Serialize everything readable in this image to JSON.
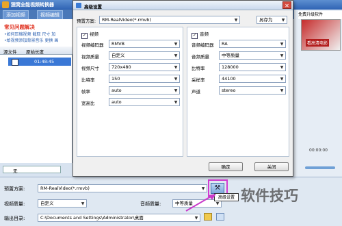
{
  "app": {
    "title": "狸窝全能视频转换器",
    "tabs": [
      "添加视频",
      "视频编辑"
    ],
    "faq": {
      "heading": "常见问题解决",
      "line1": "•如何压缩视频 截取 尺寸 加",
      "line2": "•给视频添加背景音乐 更换 画"
    },
    "list": {
      "col_source": "源文件",
      "col_duration": "原始长度",
      "row_duration": "01:48:45"
    },
    "subtitle_select": "无",
    "right_banner": "免费升级软件",
    "right_promo": "看高清电影",
    "right_time": "00:00:00"
  },
  "dialog": {
    "title": "高级设置",
    "preset_label": "预置方案:",
    "preset_value": "RM-RealVideo(*.rmvb)",
    "save_as": "另存为",
    "video": {
      "header": "视频",
      "fields": [
        {
          "label": "视频编码器",
          "value": "RMVB"
        },
        {
          "label": "视频质量",
          "value": "自定义"
        },
        {
          "label": "视频尺寸",
          "value": "720x480"
        },
        {
          "label": "比特率",
          "value": "150"
        },
        {
          "label": "帧率",
          "value": "auto"
        },
        {
          "label": "宽高比",
          "value": "auto"
        }
      ]
    },
    "audio": {
      "header": "音频",
      "fields": [
        {
          "label": "音频编码器",
          "value": "RA"
        },
        {
          "label": "音频质量",
          "value": "中等质量"
        },
        {
          "label": "比特率",
          "value": "128000"
        },
        {
          "label": "采样率",
          "value": "44100"
        },
        {
          "label": "声道",
          "value": "stereo"
        }
      ]
    },
    "ok": "确定",
    "close": "关闭"
  },
  "bottom": {
    "preset_label": "预置方案:",
    "preset_value": "RM-RealVideo(*.rmvb)",
    "video_quality_label": "视频质量:",
    "video_quality_value": "自定义",
    "audio_quality_label": "音频质量:",
    "audio_quality_value": "中等质量",
    "output_label": "输出目录:",
    "output_value": "C:\\Documents and Settings\\Administrator\\桌面",
    "tooltip": "高级设置"
  },
  "watermark": "软件技巧",
  "colors": {
    "highlight": "#d23ad2",
    "arrow": "#c93ac9",
    "faq_heading": "#e0301e",
    "title_bar": "#2f63b4"
  }
}
